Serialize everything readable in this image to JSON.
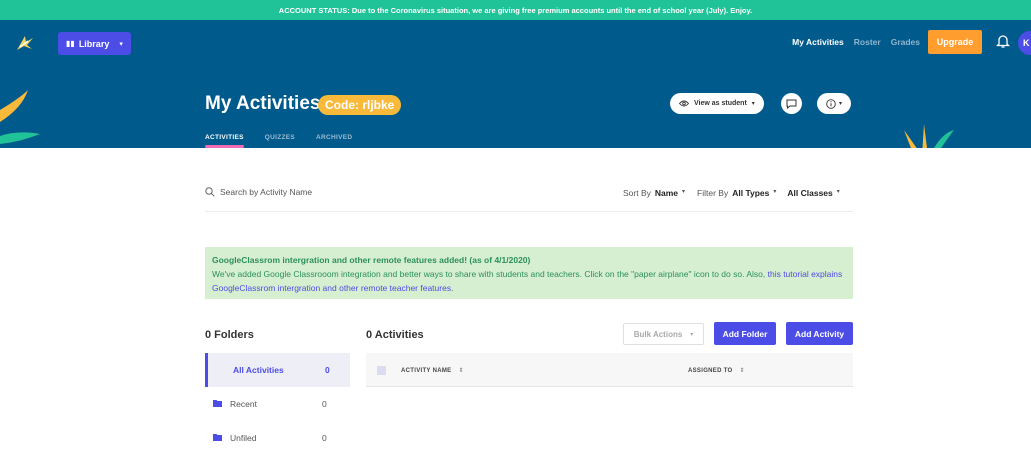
{
  "banner": {
    "text": "ACCOUNT STATUS: Due to the Coronavirus situation, we are giving free premium accounts until the end of school year (July). Enjoy."
  },
  "topnav": {
    "library_label": "Library",
    "links": [
      {
        "label": "My Activities",
        "active": true
      },
      {
        "label": "Roster",
        "active": false
      },
      {
        "label": "Grades",
        "active": false
      }
    ],
    "upgrade_label": "Upgrade",
    "avatar_initial": "K"
  },
  "header": {
    "title": "My Activities",
    "code_badge": "Code: rljbke",
    "tabs": [
      {
        "label": "ACTIVITIES",
        "active": true
      },
      {
        "label": "QUIZZES",
        "active": false
      },
      {
        "label": "ARCHIVED",
        "active": false
      }
    ],
    "view_as_student_label": "View as student"
  },
  "toolbar": {
    "search_placeholder": "Search by Activity Name",
    "sort_by_label": "Sort By",
    "sort_by_value": "Name",
    "filter_by_label": "Filter By",
    "type_filter_value": "All Types",
    "class_filter_value": "All Classes"
  },
  "alert": {
    "title": "GoogleClassrom intergration and other remote features added! (as of 4/1/2020)",
    "body_prefix": "We've added Google Classrooom integration and better ways to share with students and teachers. Click on the \"paper airplane\" icon to do so. Also, ",
    "link_text": "this tutorial explains GoogleClassrom intergration and other remote teacher features",
    "body_suffix": "."
  },
  "folders": {
    "heading": "0 Folders",
    "items": [
      {
        "label": "All Activities",
        "count": "0"
      },
      {
        "label": "Recent",
        "count": "0"
      },
      {
        "label": "Unfiled",
        "count": "0"
      }
    ]
  },
  "activities": {
    "heading": "0 Activities",
    "bulk_actions_label": "Bulk Actions",
    "add_folder_label": "Add Folder",
    "add_activity_label": "Add Activity",
    "columns": [
      "ACTIVITY NAME",
      "ASSIGNED TO"
    ]
  },
  "colors": {
    "banner": "#20c297",
    "nav": "#005a8c",
    "accent": "#4c4ce6",
    "upgrade": "#ff9d2e",
    "badge": "#f9b93a",
    "tab_underline": "#f06ab5",
    "alert_bg": "#d6efd0"
  }
}
